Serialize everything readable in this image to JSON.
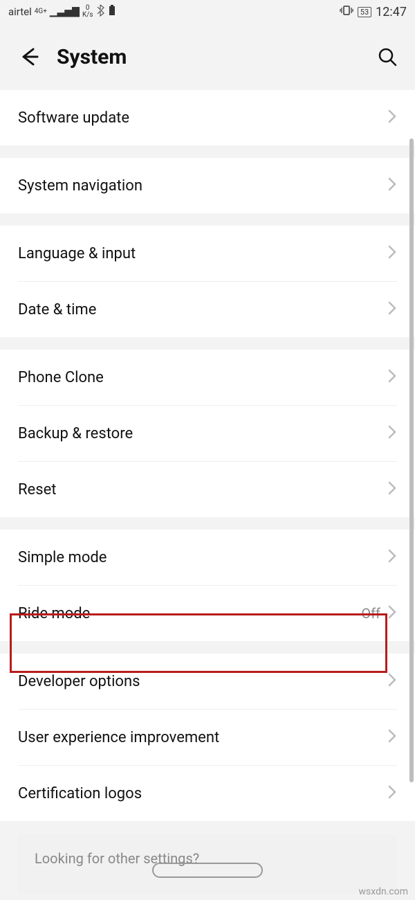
{
  "status": {
    "carrier": "airtel",
    "network_badge": "4G+",
    "speed_top": "0",
    "speed_unit": "K/s",
    "battery_pct": "53",
    "time": "12:47"
  },
  "header": {
    "title": "System"
  },
  "groups": [
    {
      "items": [
        {
          "label": "Software update",
          "value": ""
        }
      ]
    },
    {
      "items": [
        {
          "label": "System navigation",
          "value": ""
        }
      ]
    },
    {
      "items": [
        {
          "label": "Language & input",
          "value": ""
        },
        {
          "label": "Date & time",
          "value": ""
        }
      ]
    },
    {
      "items": [
        {
          "label": "Phone Clone",
          "value": ""
        },
        {
          "label": "Backup & restore",
          "value": ""
        },
        {
          "label": "Reset",
          "value": ""
        }
      ]
    },
    {
      "items": [
        {
          "label": "Simple mode",
          "value": ""
        },
        {
          "label": "Ride mode",
          "value": "Off"
        }
      ]
    },
    {
      "items": [
        {
          "label": "Developer options",
          "value": "",
          "highlighted": true
        },
        {
          "label": "User experience improvement",
          "value": ""
        },
        {
          "label": "Certification logos",
          "value": ""
        }
      ]
    }
  ],
  "footer": {
    "text": "Looking for other settings?"
  },
  "watermark": "wsxdn.com"
}
